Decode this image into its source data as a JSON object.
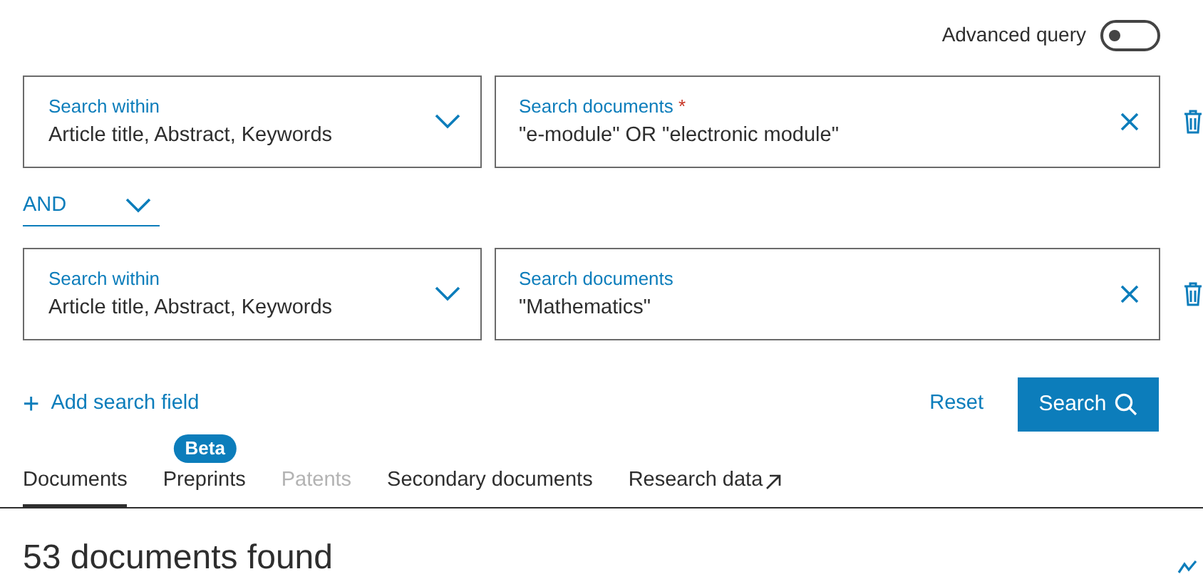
{
  "advanced_query": {
    "label": "Advanced query",
    "on": false
  },
  "search_rows": [
    {
      "within_label": "Search within",
      "within_value": "Article title, Abstract, Keywords",
      "query_label": "Search documents",
      "required": true,
      "required_mark": "*",
      "query_value": "\"e-module\" OR \"electronic module\""
    },
    {
      "within_label": "Search within",
      "within_value": "Article title, Abstract, Keywords",
      "query_label": "Search documents",
      "required": false,
      "query_value": "\"Mathematics\""
    }
  ],
  "operators": [
    "AND"
  ],
  "add_field": {
    "icon": "+",
    "label": "Add search field"
  },
  "reset": "Reset",
  "search_button": "Search",
  "tabs": [
    {
      "label": "Documents",
      "selected": true,
      "disabled": false
    },
    {
      "label": "Preprints",
      "selected": false,
      "disabled": false,
      "badge": "Beta"
    },
    {
      "label": "Patents",
      "selected": false,
      "disabled": true
    },
    {
      "label": "Secondary documents",
      "selected": false,
      "disabled": false
    },
    {
      "label": "Research data",
      "selected": false,
      "disabled": false,
      "external": true
    }
  ],
  "results_title": "53 documents found"
}
